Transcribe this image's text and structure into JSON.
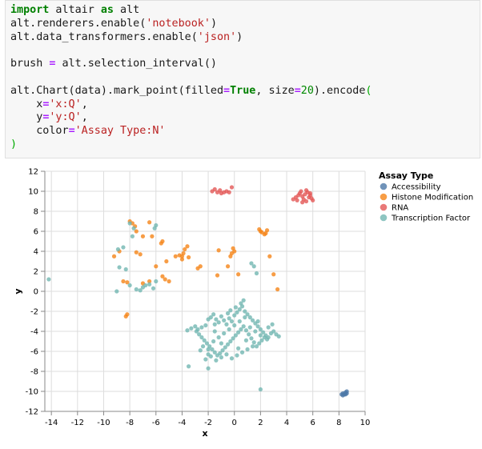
{
  "code": {
    "lines": [
      [
        [
          "kw",
          "import"
        ],
        [
          "t",
          " altair "
        ],
        [
          "kw",
          "as"
        ],
        [
          "t",
          " alt"
        ]
      ],
      [
        [
          "t",
          "alt.renderers.enable("
        ],
        [
          "str",
          "'notebook'"
        ],
        [
          "t",
          ")"
        ]
      ],
      [
        [
          "t",
          "alt.data_transformers.enable("
        ],
        [
          "str",
          "'json'"
        ],
        [
          "t",
          ")"
        ]
      ],
      [],
      [
        [
          "t",
          "brush "
        ],
        [
          "op",
          "="
        ],
        [
          "t",
          " alt.selection_interval()"
        ]
      ],
      [],
      [
        [
          "t",
          "alt.Chart(data).mark_point(filled"
        ],
        [
          "op",
          "="
        ],
        [
          "bool",
          "True"
        ],
        [
          "t",
          ", size"
        ],
        [
          "op",
          "="
        ],
        [
          "num",
          "20"
        ],
        [
          "t",
          ").encode"
        ],
        [
          "paren",
          "("
        ]
      ],
      [
        [
          "t",
          "    x"
        ],
        [
          "op",
          "="
        ],
        [
          "str",
          "'x:Q'"
        ],
        [
          "t",
          ","
        ]
      ],
      [
        [
          "t",
          "    y"
        ],
        [
          "op",
          "="
        ],
        [
          "str",
          "'y:Q'"
        ],
        [
          "t",
          ","
        ]
      ],
      [
        [
          "t",
          "    color"
        ],
        [
          "op",
          "="
        ],
        [
          "str",
          "'Assay Type:N'"
        ]
      ],
      [
        [
          "paren",
          ")"
        ]
      ]
    ]
  },
  "chart_data": {
    "type": "scatter",
    "xlabel": "x",
    "ylabel": "y",
    "xlim": [
      -14.5,
      10
    ],
    "ylim": [
      -12,
      12
    ],
    "x_ticks": [
      -14,
      -12,
      -10,
      -8,
      -6,
      -4,
      -2,
      0,
      2,
      4,
      6,
      8,
      10
    ],
    "y_ticks": [
      12,
      10,
      8,
      6,
      4,
      2,
      0,
      -2,
      -4,
      -6,
      -8,
      -10,
      -12
    ],
    "x_tick_labels": [
      "-14",
      "-12",
      "-10",
      "-8",
      "-6",
      "-4",
      "-2",
      "0",
      "2",
      "4",
      "6",
      "8",
      "10"
    ],
    "y_tick_labels": [
      "12",
      "10",
      "8",
      "6",
      "4",
      "2",
      "0",
      "-2",
      "-4",
      "-6",
      "-8",
      "-10",
      "-12"
    ],
    "grid": true,
    "legend_position": "right",
    "legend_title": "Assay Type",
    "series": [
      {
        "name": "Accessibility",
        "color": "#4c78a8",
        "points": [
          [
            8.2,
            -10.3
          ],
          [
            8.3,
            -10.2
          ],
          [
            8.4,
            -10.3
          ],
          [
            8.5,
            -10.1
          ],
          [
            8.5,
            -10.3
          ],
          [
            8.6,
            -10.0
          ],
          [
            8.3,
            -10.4
          ],
          [
            8.6,
            -10.2
          ]
        ]
      },
      {
        "name": "Histone Modification",
        "color": "#f58518",
        "points": [
          [
            -8.0,
            7.0
          ],
          [
            -7.8,
            6.8
          ],
          [
            -7.6,
            6.5
          ],
          [
            -7.5,
            6.0
          ],
          [
            -6.5,
            6.9
          ],
          [
            -6.3,
            5.5
          ],
          [
            -7.0,
            5.5
          ],
          [
            -5.6,
            4.8
          ],
          [
            -5.5,
            5.0
          ],
          [
            -8.8,
            4.0
          ],
          [
            -9.2,
            3.5
          ],
          [
            -7.5,
            3.9
          ],
          [
            -7.2,
            3.7
          ],
          [
            -6.0,
            2.5
          ],
          [
            -5.2,
            3.0
          ],
          [
            -4.5,
            3.5
          ],
          [
            -4.2,
            3.6
          ],
          [
            -4.0,
            3.5
          ],
          [
            -3.9,
            3.8
          ],
          [
            -3.8,
            4.2
          ],
          [
            -3.6,
            4.5
          ],
          [
            -4.0,
            3.2
          ],
          [
            -3.5,
            3.4
          ],
          [
            -2.8,
            2.3
          ],
          [
            -2.6,
            2.5
          ],
          [
            -5.5,
            1.5
          ],
          [
            -5.3,
            1.2
          ],
          [
            -5.0,
            1.0
          ],
          [
            -6.5,
            1.0
          ],
          [
            -7.0,
            0.8
          ],
          [
            -8.2,
            0.9
          ],
          [
            -8.5,
            1.0
          ],
          [
            -8.3,
            -2.5
          ],
          [
            -8.2,
            -2.3
          ],
          [
            -1.3,
            1.6
          ],
          [
            -1.2,
            4.1
          ],
          [
            -0.5,
            2.5
          ],
          [
            0.0,
            4.0
          ],
          [
            -0.2,
            3.8
          ],
          [
            -0.3,
            3.5
          ],
          [
            -0.1,
            4.3
          ],
          [
            0.3,
            1.7
          ],
          [
            1.9,
            6.2
          ],
          [
            2.0,
            6.0
          ],
          [
            2.1,
            5.9
          ],
          [
            2.3,
            5.7
          ],
          [
            2.4,
            5.8
          ],
          [
            2.5,
            6.1
          ],
          [
            2.7,
            3.5
          ],
          [
            3.0,
            1.7
          ],
          [
            3.3,
            0.2
          ]
        ]
      },
      {
        "name": "RNA",
        "color": "#e45756",
        "points": [
          [
            -1.7,
            10.0
          ],
          [
            -1.5,
            10.2
          ],
          [
            -1.3,
            9.9
          ],
          [
            -1.1,
            10.1
          ],
          [
            -1.0,
            9.8
          ],
          [
            -0.8,
            9.9
          ],
          [
            -0.6,
            10.0
          ],
          [
            -0.4,
            9.9
          ],
          [
            -0.2,
            10.4
          ],
          [
            4.5,
            9.2
          ],
          [
            4.7,
            9.4
          ],
          [
            4.8,
            9.1
          ],
          [
            4.9,
            9.6
          ],
          [
            5.0,
            9.8
          ],
          [
            5.1,
            10.0
          ],
          [
            5.2,
            9.5
          ],
          [
            5.3,
            9.2
          ],
          [
            5.4,
            9.7
          ],
          [
            5.5,
            10.1
          ],
          [
            5.6,
            9.9
          ],
          [
            5.7,
            9.4
          ],
          [
            5.8,
            9.8
          ],
          [
            5.9,
            9.3
          ],
          [
            6.0,
            9.1
          ],
          [
            5.5,
            9.0
          ],
          [
            5.2,
            8.9
          ],
          [
            5.8,
            9.6
          ]
        ]
      },
      {
        "name": "Transcription Factor",
        "color": "#72b7b2",
        "points": [
          [
            -14.2,
            1.2
          ],
          [
            -8.0,
            6.8
          ],
          [
            -7.7,
            6.3
          ],
          [
            -7.8,
            5.5
          ],
          [
            -6.0,
            6.6
          ],
          [
            -6.1,
            6.3
          ],
          [
            -8.9,
            4.2
          ],
          [
            -8.5,
            4.4
          ],
          [
            -8.3,
            2.2
          ],
          [
            -8.8,
            2.4
          ],
          [
            -8.0,
            0.6
          ],
          [
            -7.5,
            0.2
          ],
          [
            -7.0,
            0.4
          ],
          [
            -6.8,
            0.6
          ],
          [
            -6.5,
            0.7
          ],
          [
            -6.2,
            0.3
          ],
          [
            -6.0,
            1.0
          ],
          [
            -9.0,
            0.0
          ],
          [
            -7.2,
            0.1
          ],
          [
            1.3,
            2.8
          ],
          [
            1.5,
            2.5
          ],
          [
            1.7,
            1.8
          ],
          [
            -1.5,
            -4.0
          ],
          [
            -2.0,
            -7.7
          ],
          [
            -3.5,
            -7.5
          ],
          [
            2.0,
            -9.8
          ],
          [
            -2.8,
            -3.8
          ],
          [
            -2.5,
            -3.6
          ],
          [
            -2.2,
            -3.4
          ],
          [
            -2.0,
            -2.8
          ],
          [
            -1.8,
            -2.6
          ],
          [
            -1.6,
            -2.3
          ],
          [
            -1.4,
            -2.8
          ],
          [
            -1.2,
            -3.1
          ],
          [
            -1.0,
            -2.5
          ],
          [
            -0.8,
            -2.9
          ],
          [
            -0.6,
            -3.3
          ],
          [
            -0.4,
            -2.7
          ],
          [
            -0.2,
            -3.0
          ],
          [
            0.0,
            -2.4
          ],
          [
            0.2,
            -2.1
          ],
          [
            0.4,
            -1.8
          ],
          [
            0.6,
            -1.5
          ],
          [
            0.8,
            -2.0
          ],
          [
            1.0,
            -2.3
          ],
          [
            1.2,
            -2.6
          ],
          [
            1.4,
            -2.9
          ],
          [
            1.6,
            -3.2
          ],
          [
            1.8,
            -3.5
          ],
          [
            2.0,
            -3.8
          ],
          [
            2.2,
            -4.1
          ],
          [
            2.4,
            -4.4
          ],
          [
            2.6,
            -4.6
          ],
          [
            2.8,
            -4.2
          ],
          [
            3.0,
            -4.0
          ],
          [
            3.2,
            -4.3
          ],
          [
            3.4,
            -4.5
          ],
          [
            -2.9,
            -4.0
          ],
          [
            -2.7,
            -4.3
          ],
          [
            -2.5,
            -4.6
          ],
          [
            -2.3,
            -4.9
          ],
          [
            -2.1,
            -5.2
          ],
          [
            -1.9,
            -5.5
          ],
          [
            -1.7,
            -5.8
          ],
          [
            -1.5,
            -6.1
          ],
          [
            -1.3,
            -6.4
          ],
          [
            -1.1,
            -6.2
          ],
          [
            -0.9,
            -5.9
          ],
          [
            -0.7,
            -5.6
          ],
          [
            -0.5,
            -5.3
          ],
          [
            -0.3,
            -5.0
          ],
          [
            -0.1,
            -4.7
          ],
          [
            0.1,
            -4.4
          ],
          [
            0.3,
            -4.1
          ],
          [
            0.5,
            -3.8
          ],
          [
            0.7,
            -3.5
          ],
          [
            0.9,
            -3.9
          ],
          [
            1.1,
            -4.3
          ],
          [
            1.3,
            -4.7
          ],
          [
            1.5,
            -5.1
          ],
          [
            1.7,
            -5.5
          ],
          [
            1.9,
            -5.2
          ],
          [
            2.1,
            -4.9
          ],
          [
            2.3,
            -4.6
          ],
          [
            2.5,
            -4.8
          ],
          [
            -2.2,
            -6.8
          ],
          [
            -1.8,
            -6.5
          ],
          [
            -1.4,
            -6.9
          ],
          [
            -1.0,
            -6.6
          ],
          [
            -0.6,
            -6.3
          ],
          [
            -0.2,
            -6.7
          ],
          [
            0.2,
            -6.4
          ],
          [
            0.6,
            -6.1
          ],
          [
            1.0,
            -5.8
          ],
          [
            1.4,
            -5.5
          ],
          [
            -2.4,
            -5.5
          ],
          [
            -2.0,
            -5.8
          ],
          [
            -1.6,
            -5.0
          ],
          [
            -1.2,
            -4.6
          ],
          [
            -0.8,
            -4.2
          ],
          [
            -0.4,
            -3.8
          ],
          [
            0.0,
            -3.4
          ],
          [
            0.4,
            -3.0
          ],
          [
            0.8,
            -2.6
          ],
          [
            1.2,
            -3.6
          ],
          [
            1.6,
            -4.0
          ],
          [
            2.0,
            -4.4
          ],
          [
            -3.6,
            -3.9
          ],
          [
            -3.3,
            -3.7
          ],
          [
            -3.0,
            -3.5
          ],
          [
            0.5,
            -1.2
          ],
          [
            0.7,
            -0.9
          ],
          [
            0.1,
            -1.6
          ],
          [
            -0.3,
            -1.9
          ],
          [
            2.6,
            -3.6
          ],
          [
            2.9,
            -3.3
          ],
          [
            -2.6,
            -5.9
          ],
          [
            -2.0,
            -6.3
          ],
          [
            -1.0,
            -5.2
          ],
          [
            0.3,
            -5.7
          ],
          [
            0.9,
            -4.9
          ],
          [
            1.8,
            -3.0
          ],
          [
            -0.5,
            -2.2
          ],
          [
            -1.5,
            -3.3
          ]
        ]
      }
    ]
  }
}
